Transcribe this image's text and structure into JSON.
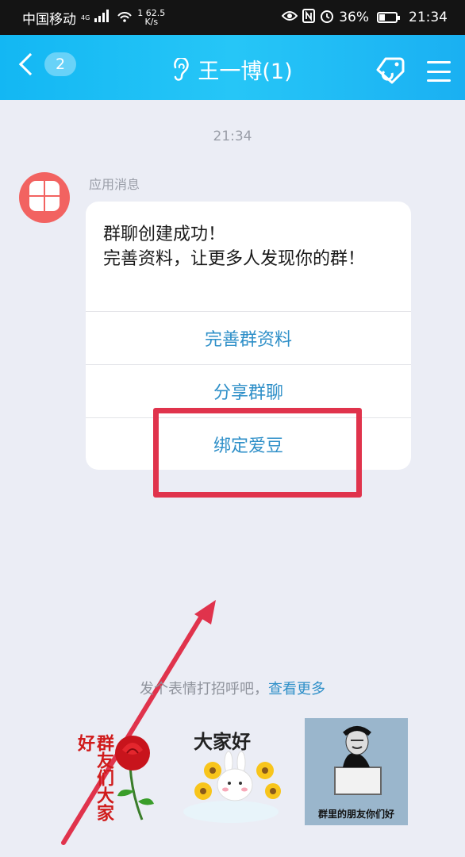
{
  "status_bar": {
    "carrier": "中国移动",
    "network": "4G",
    "speed_value": "62.5",
    "speed_unit": "K/s",
    "speed_prefix": "1",
    "battery": "36%",
    "battery_level": 0.36,
    "time": "21:34"
  },
  "nav": {
    "back_badge": "2",
    "title": "王一博(1)",
    "icons": [
      "back-chevron-icon",
      "ear-icon",
      "tag-icon",
      "menu-icon"
    ]
  },
  "chat": {
    "timestamp": "21:34",
    "sender": "应用消息",
    "message_line1": "群聊创建成功！",
    "message_line2": "完善资料，让更多人发现你的群！",
    "buttons": [
      "完善群资料",
      "分享群聊",
      "绑定爱豆"
    ]
  },
  "prompt": {
    "text": "发个表情打招呼吧，",
    "link": "查看更多"
  },
  "stickers": {
    "sticker1_text": "群友们大家好",
    "sticker2_text": "大家好",
    "sticker3_text": "群里的朋友你们好"
  },
  "colors": {
    "nav_bg": "#1fbff5",
    "accent_link": "#2e8fc8",
    "annotation_red": "#e0334c",
    "avatar_bg": "#f26361"
  }
}
